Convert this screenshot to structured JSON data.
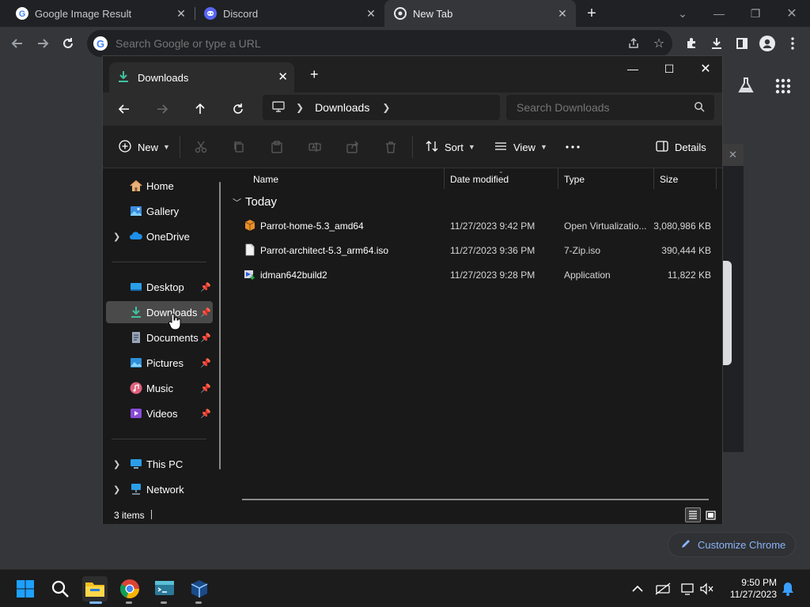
{
  "chrome": {
    "tabs": [
      {
        "title": "Google Image Result",
        "favicon": "google-g-icon",
        "active": false
      },
      {
        "title": "Discord",
        "favicon": "discord-icon",
        "active": false
      },
      {
        "title": "New Tab",
        "favicon": "chrome-icon",
        "active": true
      }
    ],
    "omnibox_placeholder": "Search Google or type a URL",
    "customize_label": "Customize Chrome"
  },
  "explorer": {
    "tab_title": "Downloads",
    "breadcrumb": [
      "Downloads"
    ],
    "search_placeholder": "Search Downloads",
    "commands": {
      "new": "New",
      "sort": "Sort",
      "view": "View",
      "details": "Details"
    },
    "nav": {
      "quick": [
        {
          "label": "Home",
          "icon": "home-icon"
        },
        {
          "label": "Gallery",
          "icon": "gallery-icon"
        },
        {
          "label": "OneDrive",
          "icon": "onedrive-icon"
        }
      ],
      "pinned": [
        {
          "label": "Desktop",
          "icon": "desktop-folder-icon"
        },
        {
          "label": "Downloads",
          "icon": "downloads-folder-icon"
        },
        {
          "label": "Documents",
          "icon": "documents-folder-icon"
        },
        {
          "label": "Pictures",
          "icon": "pictures-folder-icon"
        },
        {
          "label": "Music",
          "icon": "music-folder-icon"
        },
        {
          "label": "Videos",
          "icon": "videos-folder-icon"
        }
      ],
      "devices": [
        {
          "label": "This PC",
          "icon": "this-pc-icon"
        },
        {
          "label": "Network",
          "icon": "network-icon"
        }
      ],
      "selected": "Downloads"
    },
    "columns": {
      "name": "Name",
      "date": "Date modified",
      "type": "Type",
      "size": "Size"
    },
    "group_label": "Today",
    "files": [
      {
        "name": "Parrot-home-5.3_amd64",
        "date": "11/27/2023 9:42 PM",
        "type": "Open Virtualizatio...",
        "size": "3,080,986 KB",
        "icon": "ova-package-icon"
      },
      {
        "name": "Parrot-architect-5.3_arm64.iso",
        "date": "11/27/2023 9:36 PM",
        "type": "7-Zip.iso",
        "size": "390,444 KB",
        "icon": "file-icon"
      },
      {
        "name": "idman642build2",
        "date": "11/27/2023 9:28 PM",
        "type": "Application",
        "size": "11,822 KB",
        "icon": "installer-app-icon"
      }
    ],
    "status": "3 items"
  },
  "taskbar": {
    "time": "9:50 PM",
    "date": "11/27/2023"
  },
  "colors": {
    "chrome_bg": "#35363a",
    "explorer_bg": "#191919",
    "accent_blue": "#8ab4f8",
    "selection": "#4a4a4a"
  }
}
